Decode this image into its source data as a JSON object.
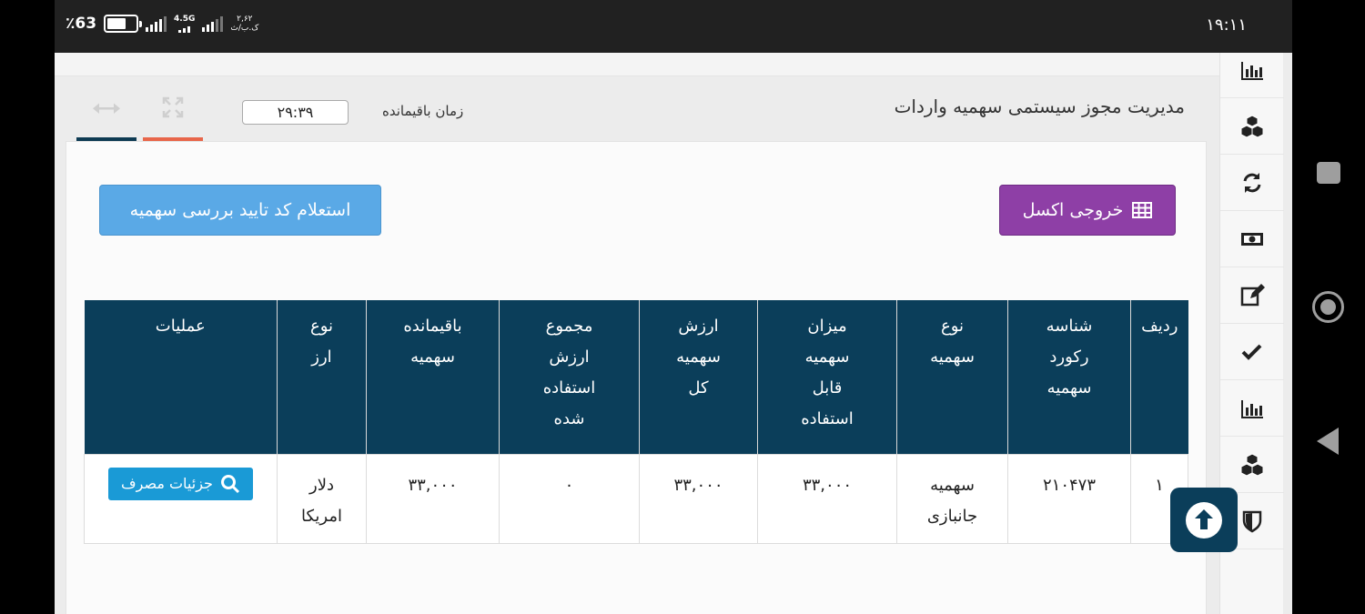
{
  "status_bar": {
    "time": "۱۹:۱۱",
    "battery_percent": "٪63",
    "network_type": "4.5G",
    "speed_value": "۲,۶۲",
    "speed_unit": "ک.ب/ث",
    "icons": [
      "battery-icon",
      "signal-icon",
      "network-signal-icon"
    ]
  },
  "header": {
    "title": "مدیریت مجوز سیستمی سهمیه واردات",
    "timer_label": "زمان باقیمانده",
    "timer_value": "۲۹:۳۹",
    "icons": [
      "expand-icon",
      "horizontal-arrows-icon"
    ]
  },
  "actions": {
    "excel_label": "خروجی اکسل",
    "inquiry_label": "استعلام کد تایید بررسی سهمیه"
  },
  "table": {
    "columns": [
      [
        "ردیف"
      ],
      [
        "شناسه",
        "رکورد",
        "سهمیه"
      ],
      [
        "نوع",
        "سهمیه"
      ],
      [
        "میزان",
        "سهمیه",
        "قابل",
        "استفاده"
      ],
      [
        "ارزش",
        "سهمیه",
        "کل"
      ],
      [
        "مجموع",
        "ارزش",
        "استفاده",
        "شده"
      ],
      [
        "باقیمانده",
        "سهمیه"
      ],
      [
        "نوع",
        "ارز"
      ],
      [
        "عملیات"
      ]
    ],
    "rows": [
      {
        "row_no": "۱",
        "record_id": "۲۱۰۴۷۳",
        "quota_type": [
          "سهمیه",
          "جانبازی"
        ],
        "usable_amount": "۳۳,۰۰۰",
        "total_value": "۳۳,۰۰۰",
        "used_total": "۰",
        "remaining": "۳۳,۰۰۰",
        "currency": [
          "دلار",
          "امریکا"
        ],
        "details_label": "جزئیات مصرف"
      }
    ]
  },
  "sidebar": {
    "icons": [
      "bar-chart-icon",
      "cubes-icon",
      "refresh-icon",
      "money-icon",
      "edit-icon",
      "check-icon",
      "bar-chart-icon",
      "cubes-icon",
      "shield-icon"
    ]
  },
  "colors": {
    "header_bg": "#0b3e5a",
    "excel_button": "#8e3fa6",
    "inquiry_button": "#5aa9e6",
    "details_button": "#1a9ad6",
    "tab_mark_accent": "#e8664a"
  }
}
